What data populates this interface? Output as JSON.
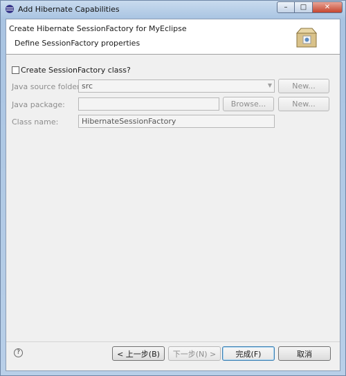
{
  "window": {
    "title": "Add Hibernate Capabilities",
    "controls": {
      "minimize": "–",
      "maximize": "□",
      "close": "✕"
    }
  },
  "banner": {
    "title": "Create Hibernate SessionFactory for MyEclipse",
    "subtitle": "Define SessionFactory properties",
    "icon": "package-box-icon"
  },
  "form": {
    "create_checkbox": {
      "label": "Create SessionFactory class?",
      "checked": false
    },
    "source_folder": {
      "label": "Java source folder:",
      "value": "src",
      "new_button": "New..."
    },
    "package": {
      "label": "Java package:",
      "value": "",
      "browse_button": "Browse...",
      "new_button": "New..."
    },
    "class_name": {
      "label": "Class name:",
      "value": "HibernateSessionFactory"
    }
  },
  "footer": {
    "help_icon": "?",
    "back_button": "< 上一步(B)",
    "next_button": "下一步(N) >",
    "finish_button": "完成(F)",
    "cancel_button": "取消"
  }
}
